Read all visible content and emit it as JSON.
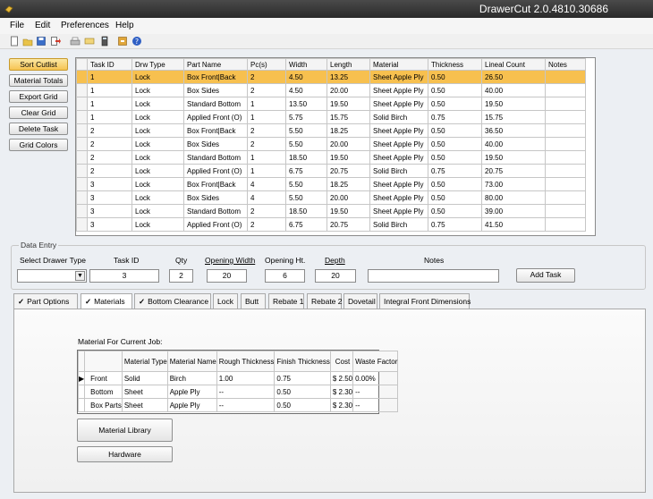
{
  "window": {
    "title": "DrawerCut 2.0.4810.30686"
  },
  "menu": [
    "File",
    "Edit",
    "Preferences",
    "Help"
  ],
  "left_buttons": [
    "Sort Cutlist",
    "Material Totals",
    "Export Grid",
    "Clear Grid",
    "Delete Task",
    "Grid Colors"
  ],
  "cutlist": {
    "columns": [
      "Task ID",
      "Drw Type",
      "Part Name",
      "Pc(s)",
      "Width",
      "Length",
      "Material",
      "Thickness",
      "Lineal Count",
      "Notes"
    ],
    "rows": [
      [
        "1",
        "Lock",
        "Box Front|Back",
        "2",
        "4.50",
        "13.25",
        "Sheet Apple Ply",
        "0.50",
        "26.50",
        ""
      ],
      [
        "1",
        "Lock",
        "Box Sides",
        "2",
        "4.50",
        "20.00",
        "Sheet Apple Ply",
        "0.50",
        "40.00",
        ""
      ],
      [
        "1",
        "Lock",
        "Standard Bottom",
        "1",
        "13.50",
        "19.50",
        "Sheet Apple Ply",
        "0.50",
        "19.50",
        ""
      ],
      [
        "1",
        "Lock",
        "Applied Front (O)",
        "1",
        "5.75",
        "15.75",
        "Solid Birch",
        "0.75",
        "15.75",
        ""
      ],
      [
        "2",
        "Lock",
        "Box Front|Back",
        "2",
        "5.50",
        "18.25",
        "Sheet Apple Ply",
        "0.50",
        "36.50",
        ""
      ],
      [
        "2",
        "Lock",
        "Box Sides",
        "2",
        "5.50",
        "20.00",
        "Sheet Apple Ply",
        "0.50",
        "40.00",
        ""
      ],
      [
        "2",
        "Lock",
        "Standard Bottom",
        "1",
        "18.50",
        "19.50",
        "Sheet Apple Ply",
        "0.50",
        "19.50",
        ""
      ],
      [
        "2",
        "Lock",
        "Applied Front (O)",
        "1",
        "6.75",
        "20.75",
        "Solid Birch",
        "0.75",
        "20.75",
        ""
      ],
      [
        "3",
        "Lock",
        "Box Front|Back",
        "4",
        "5.50",
        "18.25",
        "Sheet Apple Ply",
        "0.50",
        "73.00",
        ""
      ],
      [
        "3",
        "Lock",
        "Box Sides",
        "4",
        "5.50",
        "20.00",
        "Sheet Apple Ply",
        "0.50",
        "80.00",
        ""
      ],
      [
        "3",
        "Lock",
        "Standard Bottom",
        "2",
        "18.50",
        "19.50",
        "Sheet Apple Ply",
        "0.50",
        "39.00",
        ""
      ],
      [
        "3",
        "Lock",
        "Applied Front (O)",
        "2",
        "6.75",
        "20.75",
        "Solid Birch",
        "0.75",
        "41.50",
        ""
      ]
    ]
  },
  "data_entry": {
    "legend": "Data Entry",
    "labels": {
      "drawer_type": "Select Drawer Type",
      "task_id": "Task ID",
      "qty": "Qty",
      "opening_width": "Opening Width",
      "opening_ht": "Opening Ht.",
      "depth": "Depth",
      "notes": "Notes"
    },
    "values": {
      "drawer_type": "",
      "task_id": "3",
      "qty": "2",
      "opening_width": "20",
      "opening_ht": "6",
      "depth": "20",
      "notes": ""
    },
    "add_button": "Add Task"
  },
  "tabs": [
    {
      "label": "Part Options",
      "checked": true
    },
    {
      "label": "Materials",
      "checked": true
    },
    {
      "label": "Bottom Clearance",
      "checked": true
    },
    {
      "label": "Lock",
      "checked": false
    },
    {
      "label": "Butt",
      "checked": false
    },
    {
      "label": "Rebate 1",
      "checked": false
    },
    {
      "label": "Rebate 2",
      "checked": false
    },
    {
      "label": "Dovetail",
      "checked": false
    },
    {
      "label": "Integral Front Dimensions",
      "checked": false
    }
  ],
  "materials": {
    "heading": "Material For Current Job:",
    "columns": [
      "Material Type",
      "Material Name",
      "Rough Thickness",
      "Finish Thickness",
      "Cost",
      "Waste Factor"
    ],
    "rows": [
      {
        "label": "Front",
        "cells": [
          "Solid",
          "Birch",
          "1.00",
          "0.75",
          "$ 2.50",
          "0.00%"
        ]
      },
      {
        "label": "Bottom",
        "cells": [
          "Sheet",
          "Apple Ply",
          "--",
          "0.50",
          "$ 2.30",
          "--"
        ]
      },
      {
        "label": "Box Parts",
        "cells": [
          "Sheet",
          "Apple Ply",
          "--",
          "0.50",
          "$ 2.30",
          "--"
        ]
      }
    ],
    "buttons": [
      "Material Library",
      "Hardware"
    ]
  },
  "colors": {
    "selected_row": "#f7c04f",
    "active_button": "#f6c453"
  }
}
